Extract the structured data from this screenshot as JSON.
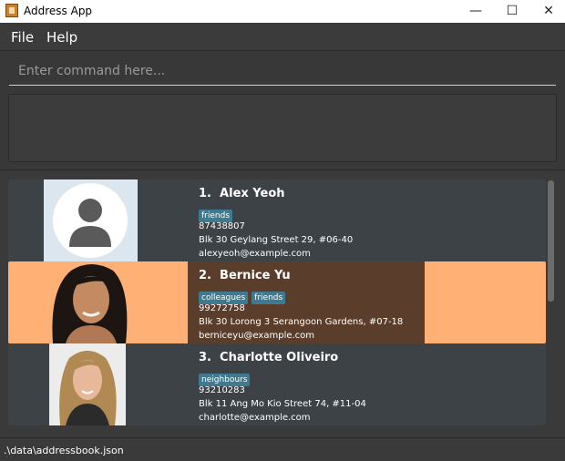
{
  "window": {
    "title": "Address App",
    "minimize_glyph": "—",
    "maximize_glyph": "☐",
    "close_glyph": "✕"
  },
  "menu": {
    "items": [
      {
        "label": "File"
      },
      {
        "label": "Help"
      }
    ]
  },
  "command": {
    "placeholder": "Enter command here...",
    "value": ""
  },
  "result": {
    "text": ""
  },
  "persons": [
    {
      "index": "1.",
      "name": "Alex Yeoh",
      "tags": [
        "friends"
      ],
      "phone": "87438807",
      "address": "Blk 30 Geylang Street 29, #06-40",
      "email": "alexyeoh@example.com",
      "photo_icon": "default-avatar-icon",
      "selected": false
    },
    {
      "index": "2.",
      "name": "Bernice Yu",
      "tags": [
        "colleagues",
        "friends"
      ],
      "phone": "99272758",
      "address": "Blk 30 Lorong 3 Serangoon Gardens, #07-18",
      "email": "berniceyu@example.com",
      "photo_icon": "person-photo-icon",
      "selected": true
    },
    {
      "index": "3.",
      "name": "Charlotte Oliveiro",
      "tags": [
        "neighbours"
      ],
      "phone": "93210283",
      "address": "Blk 11 Ang Mo Kio Street 74, #11-04",
      "email": "charlotte@example.com",
      "photo_icon": "person-photo-icon",
      "selected": false
    }
  ],
  "status": {
    "file_path": ".\\data\\addressbook.json"
  },
  "colors": {
    "background": "#383838",
    "card": "#3d4247",
    "selected_card": "#ffb074",
    "selected_info": "#5a3d2b",
    "tag": "#3e7b91"
  }
}
